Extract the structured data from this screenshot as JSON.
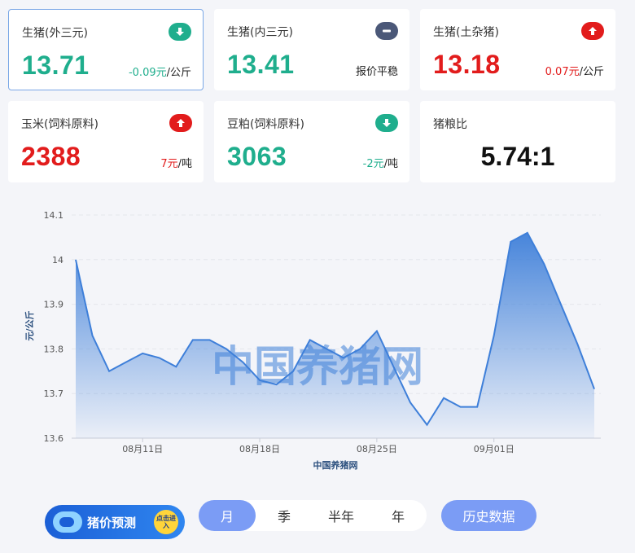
{
  "cards": [
    {
      "title": "生猪(外三元)",
      "price": "13.71",
      "change_num": "-0.09元",
      "change_unit": "/公斤",
      "trend": "down"
    },
    {
      "title": "生猪(内三元)",
      "price": "13.41",
      "change_text": "报价平稳",
      "trend": "flat"
    },
    {
      "title": "生猪(土杂猪)",
      "price": "13.18",
      "change_num": "0.07元",
      "change_unit": "/公斤",
      "trend": "up"
    },
    {
      "title": "玉米(饲料原料)",
      "price": "2388",
      "change_num": "7元",
      "change_unit": "/吨",
      "trend": "up"
    },
    {
      "title": "豆粕(饲料原料)",
      "price": "3063",
      "change_num": "-2元",
      "change_unit": "/吨",
      "trend": "down"
    },
    {
      "title": "猪粮比",
      "ratio": "5.74:1"
    }
  ],
  "colors": {
    "up": "#e21c1c",
    "down": "#1fae8d",
    "flat": "#4b5878",
    "accent": "#7b9cf5",
    "line": "#3e7fd9"
  },
  "chart_data": {
    "type": "area",
    "title": "",
    "xlabel": "中国养猪网",
    "ylabel": "元/公斤",
    "watermark": "中国养猪网",
    "ylim": [
      13.6,
      14.1
    ],
    "yticks": [
      "13.6",
      "13.7",
      "13.8",
      "13.9",
      "14",
      "14.1"
    ],
    "xticks": [
      {
        "label": "08月11日",
        "index": 4
      },
      {
        "label": "08月18日",
        "index": 11
      },
      {
        "label": "08月25日",
        "index": 18
      },
      {
        "label": "09月01日",
        "index": 25
      }
    ],
    "series": [
      {
        "values": [
          14.0,
          13.83,
          13.75,
          13.77,
          13.79,
          13.78,
          13.76,
          13.82,
          13.82,
          13.8,
          13.77,
          13.73,
          13.72,
          13.75,
          13.82,
          13.8,
          13.78,
          13.8,
          13.84,
          13.76,
          13.68,
          13.63,
          13.69,
          13.67,
          13.67,
          13.83,
          14.04,
          14.06,
          13.99,
          13.9,
          13.81,
          13.71
        ]
      }
    ],
    "grid": true
  },
  "controls": {
    "promo_label": "猪价预测",
    "promo_badge": "点击进入",
    "tabs": [
      "月",
      "季",
      "半年",
      "年"
    ],
    "active_tab": "月",
    "history_label": "历史数据"
  }
}
